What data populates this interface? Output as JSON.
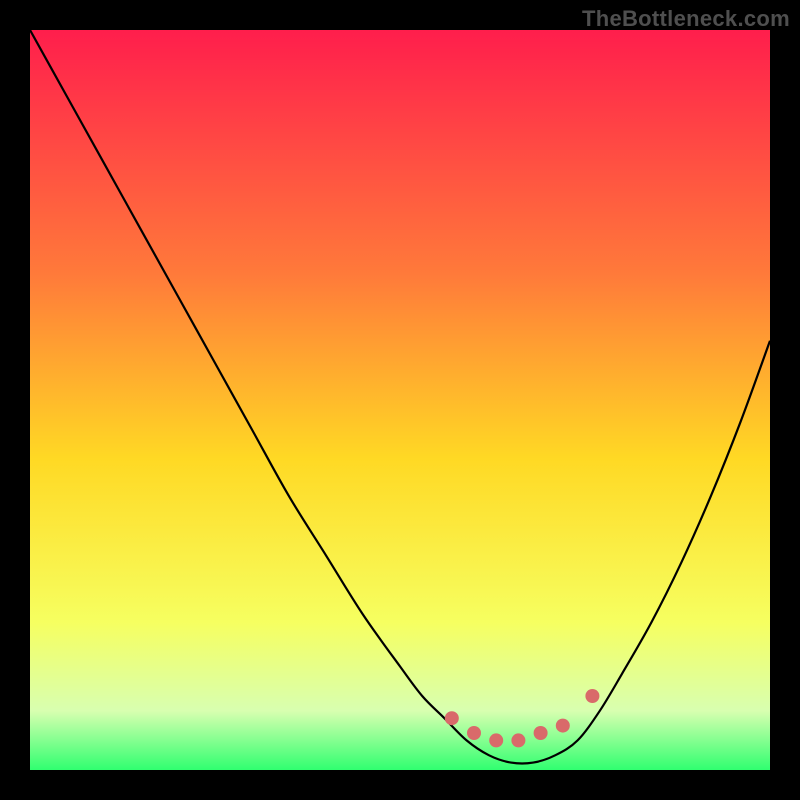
{
  "attribution": "TheBottleneck.com",
  "colors": {
    "gradient_top": "#ff1e4c",
    "gradient_upper_mid": "#ff7a3a",
    "gradient_mid": "#ffd924",
    "gradient_lower_mid": "#f6ff60",
    "gradient_low": "#d8ffb0",
    "gradient_bottom": "#30ff70",
    "curve": "#000000",
    "marker": "#d96a6a",
    "frame": "#000000"
  },
  "chart_data": {
    "type": "line",
    "title": "",
    "xlabel": "",
    "ylabel": "",
    "xlim": [
      0,
      100
    ],
    "ylim": [
      0,
      100
    ],
    "series": [
      {
        "name": "bottleneck-curve",
        "x": [
          0,
          5,
          10,
          15,
          20,
          25,
          30,
          35,
          40,
          45,
          50,
          53,
          56,
          59,
          62,
          65,
          68,
          71,
          74,
          77,
          80,
          84,
          88,
          92,
          96,
          100
        ],
        "y": [
          100,
          91,
          82,
          73,
          64,
          55,
          46,
          37,
          29,
          21,
          14,
          10,
          7,
          4,
          2,
          1,
          1,
          2,
          4,
          8,
          13,
          20,
          28,
          37,
          47,
          58
        ]
      }
    ],
    "markers": [
      {
        "name": "flat-region-left-edge",
        "x": 57,
        "y": 7
      },
      {
        "name": "flat-region-1",
        "x": 60,
        "y": 5
      },
      {
        "name": "flat-region-2",
        "x": 63,
        "y": 4
      },
      {
        "name": "flat-region-3",
        "x": 66,
        "y": 4
      },
      {
        "name": "flat-region-4",
        "x": 69,
        "y": 5
      },
      {
        "name": "flat-region-right-edge",
        "x": 72,
        "y": 6
      },
      {
        "name": "secondary-marker",
        "x": 76,
        "y": 10
      }
    ]
  }
}
